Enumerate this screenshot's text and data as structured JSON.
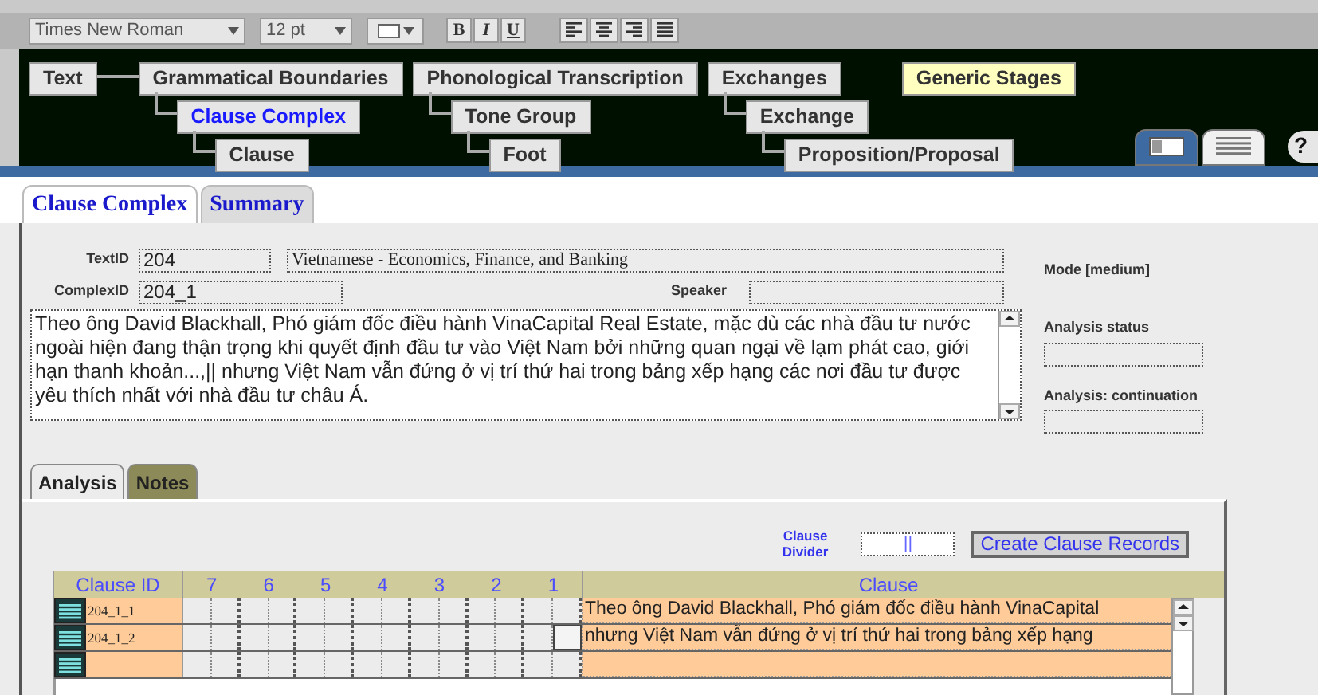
{
  "toolbar": {
    "font": "Times New Roman",
    "size": "12 pt",
    "styles": [
      "B",
      "I",
      "U"
    ]
  },
  "nav": {
    "nodes": [
      {
        "label": "Text",
        "selected": false,
        "highlighted": false
      },
      {
        "label": "Grammatical Boundaries",
        "selected": false,
        "highlighted": false,
        "children": [
          {
            "label": "Clause Complex",
            "selected": true,
            "highlighted": false,
            "children": [
              {
                "label": "Clause",
                "selected": false,
                "highlighted": false
              }
            ]
          }
        ]
      },
      {
        "label": "Phonological Transcription",
        "selected": false,
        "highlighted": false,
        "children": [
          {
            "label": "Tone Group",
            "selected": false,
            "highlighted": false,
            "children": [
              {
                "label": "Foot",
                "selected": false,
                "highlighted": false
              }
            ]
          }
        ]
      },
      {
        "label": "Exchanges",
        "selected": false,
        "highlighted": false,
        "children": [
          {
            "label": "Exchange",
            "selected": false,
            "highlighted": false,
            "children": [
              {
                "label": "Proposition/Proposal",
                "selected": false,
                "highlighted": false
              }
            ]
          }
        ]
      },
      {
        "label": "Generic Stages",
        "selected": false,
        "highlighted": true
      }
    ],
    "views": [
      {
        "kind": "form",
        "selected": true
      },
      {
        "kind": "list",
        "selected": false
      }
    ],
    "help": "?"
  },
  "tabs": [
    {
      "label": "Clause Complex",
      "selected": true
    },
    {
      "label": "Summary",
      "selected": false
    }
  ],
  "form": {
    "text_id_label": "TextID",
    "text_id": "204",
    "text_title": "Vietnamese - Economics, Finance, and Banking",
    "complex_id_label": "ComplexID",
    "complex_id": "204_1",
    "speaker_label": "Speaker",
    "text": "Theo ông David Blackhall, Phó giám đốc điều hành VinaCapital Real Estate, mặc dù các nhà đầu tư nước ngoài hiện đang thận trọng khi quyết định đầu tư vào Việt Nam bởi những quan ngại về lạm phát cao, giới hạn thanh khoản...,|| nhưng Việt Nam vẫn đứng ở vị trí thứ hai trong bảng xếp hạng các nơi đầu tư được yêu thích nhất với nhà đầu tư châu Á."
  },
  "side": {
    "mode": "Mode [medium]",
    "status_label": "Analysis status",
    "continuation_label": "Analysis: continuation"
  },
  "analysis_tabs": [
    {
      "label": "Analysis",
      "selected": true
    },
    {
      "label": "Notes",
      "selected": false
    }
  ],
  "divider": {
    "label": "Clause Divider",
    "value": "||"
  },
  "create_button": "Create Clause Records",
  "table": {
    "columns": [
      "Clause ID",
      "7",
      "6",
      "5",
      "4",
      "3",
      "2",
      "1",
      "Clause"
    ],
    "rows": [
      {
        "id": "204_1_1",
        "clause": "Theo ông David Blackhall, Phó giám đốc điều hành VinaCapital",
        "slots": [
          {
            "selected": false
          },
          {
            "selected": false
          },
          {
            "selected": false
          },
          {
            "selected": false
          },
          {
            "selected": false
          },
          {
            "selected": false
          },
          {
            "selected": false
          },
          {
            "selected": false
          },
          {
            "selected": false
          },
          {
            "selected": false
          },
          {
            "selected": false
          },
          {
            "selected": false
          },
          {
            "selected": false
          },
          {
            "selected": false
          }
        ]
      },
      {
        "id": "204_1_2",
        "clause": "nhưng Việt Nam vẫn đứng ở vị trí thứ hai trong bảng xếp hạng",
        "slots": [
          {
            "selected": false
          },
          {
            "selected": false
          },
          {
            "selected": false
          },
          {
            "selected": false
          },
          {
            "selected": false
          },
          {
            "selected": false
          },
          {
            "selected": false
          },
          {
            "selected": false
          },
          {
            "selected": false
          },
          {
            "selected": false
          },
          {
            "selected": false
          },
          {
            "selected": false
          },
          {
            "selected": false
          },
          {
            "selected": true
          }
        ]
      },
      {
        "slots": [
          {
            "selected": false
          },
          {
            "selected": false
          },
          {
            "selected": false
          },
          {
            "selected": false
          },
          {
            "selected": false
          },
          {
            "selected": false
          },
          {
            "selected": false
          },
          {
            "selected": false
          },
          {
            "selected": false
          },
          {
            "selected": false
          },
          {
            "selected": false
          },
          {
            "selected": false
          },
          {
            "selected": false
          },
          {
            "selected": false
          }
        ]
      }
    ]
  }
}
